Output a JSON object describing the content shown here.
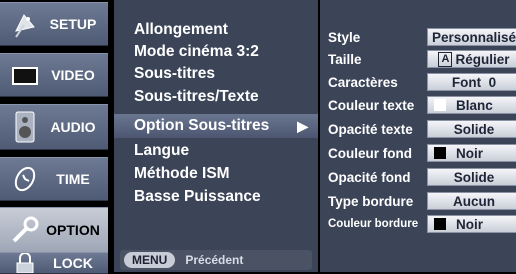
{
  "sidebar": {
    "items": [
      {
        "label": "SETUP",
        "icon": "satellite-dish-icon"
      },
      {
        "label": "VIDEO",
        "icon": "tv-screen-icon"
      },
      {
        "label": "AUDIO",
        "icon": "speaker-icon"
      },
      {
        "label": "TIME",
        "icon": "clock-icon"
      },
      {
        "label": "OPTION",
        "icon": "wrench-icon"
      },
      {
        "label": "LOCK",
        "icon": "padlock-icon"
      }
    ],
    "active_index": 4
  },
  "menu": {
    "items": [
      "Allongement",
      "Mode cinéma 3:2",
      "Sous-titres",
      "Sous-titres/Texte",
      "Option Sous-titres",
      "Langue",
      "Méthode ISM",
      "Basse Puissance"
    ],
    "selected_index": 4,
    "arrow": "▶",
    "footer_button": "MENU",
    "footer_text": "Précédent"
  },
  "options": {
    "rows": [
      {
        "label": "Style",
        "value": "Personnalisé"
      },
      {
        "label": "Taille",
        "value": "Régulier",
        "prefix": "A"
      },
      {
        "label": "Caractères",
        "value": "Font  0"
      },
      {
        "label": "Couleur texte",
        "value": "Blanc",
        "swatch": "#ffffff"
      },
      {
        "label": "Opacité texte",
        "value": "Solide"
      },
      {
        "label": "Couleur fond",
        "value": "Noir",
        "swatch": "#000000"
      },
      {
        "label": "Opacité fond",
        "value": "Solide"
      },
      {
        "label": "Type bordure",
        "value": "Aucun"
      },
      {
        "label": "Couleur bordure",
        "value": "Noir",
        "swatch": "#000000"
      }
    ]
  },
  "colors": {
    "panel": "#3c4558",
    "sidebar_tile": "#5f6b84",
    "sidebar_active": "#b8becb",
    "value_box": "#e6e9ef"
  }
}
